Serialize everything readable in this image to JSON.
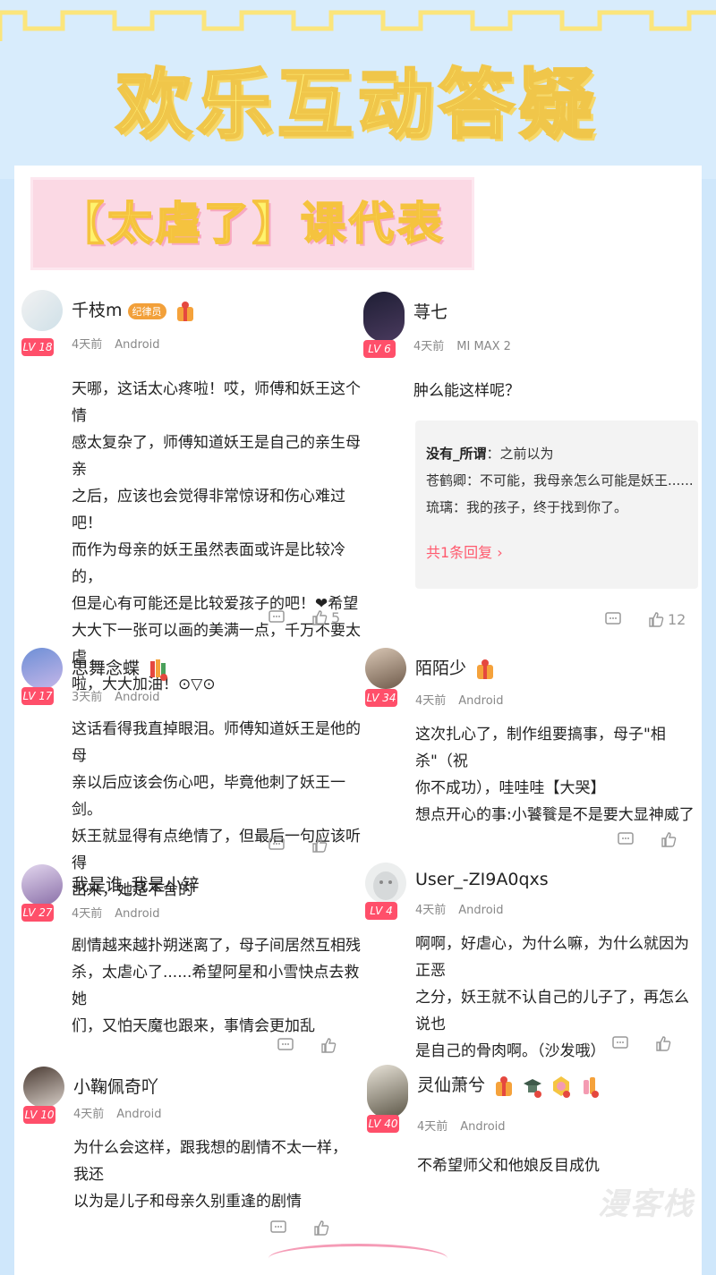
{
  "header": {
    "title": "欢乐互动答疑",
    "banner": "【太虐了】课代表"
  },
  "comments": [
    {
      "username": "千枝m",
      "badge": "纪律员",
      "level": "LV 18",
      "time": "4天前",
      "device": "Android",
      "lines": [
        "天哪，这话太心疼啦！哎，师傅和妖王这个情",
        "感太复杂了，师傅知道妖王是自己的亲生母亲",
        "之后，应该也会觉得非常惊讶和伤心难过吧！",
        "而作为母亲的妖王虽然表面或许是比较冷的，",
        "但是心有可能还是比较爱孩子的吧！❤希望",
        "大大下一张可以画的美满一点，千万不要太虐",
        "啦，大大加油！⊙▽⊙"
      ],
      "likes": "5"
    },
    {
      "username": "荨七",
      "level": "LV 6",
      "time": "4天前",
      "device": "MI MAX 2",
      "lines": [
        "肿么能这样呢？"
      ],
      "reply": {
        "name": "没有_所谓",
        "first": "之前以为",
        "line2": "苍鹤卿：不可能，我母亲怎么可能是妖王......",
        "line3": "琉璃：我的孩子，终于找到你了。",
        "more": "共1条回复 ›"
      },
      "likes": "12"
    },
    {
      "username": "思舞念蝶",
      "medal_num": "8",
      "level": "LV 17",
      "time": "3天前",
      "device": "Android",
      "lines": [
        "这话看得我直掉眼泪。师傅知道妖王是他的母",
        "亲以后应该会伤心吧，毕竟他刺了妖王一剑。",
        "妖王就显得有点绝情了，但最后一句应该听得",
        "出来，她是不舍的"
      ]
    },
    {
      "username": "陌陌少",
      "medal_num": "8",
      "level": "LV 34",
      "time": "4天前",
      "device": "Android",
      "lines": [
        "这次扎心了，制作组要搞事，母子\"相杀\"（祝",
        "你不成功），哇哇哇【大哭】",
        "想点开心的事:小饕餮是不是要大显神威了"
      ]
    },
    {
      "username": "我是谁_我是小锌",
      "level": "LV 27",
      "time": "4天前",
      "device": "Android",
      "lines": [
        "剧情越来越扑朔迷离了，母子间居然互相残",
        "杀，太虐心了......希望阿星和小雪快点去救她",
        "们，又怕天魔也跟来，事情会更加乱"
      ]
    },
    {
      "username": "User_-ZI9A0qxs",
      "level": "LV 4",
      "time": "4天前",
      "device": "Android",
      "lines": [
        "啊啊，好虐心，为什么嘛，为什么就因为正恶",
        "之分，妖王就不认自己的儿子了，再怎么说也",
        "是自己的骨肉啊。（沙发哦）"
      ]
    },
    {
      "username": "小鞠佩奇吖",
      "level": "LV 10",
      "time": "4天前",
      "device": "Android",
      "lines": [
        "为什么会这样，跟我想的剧情不太一样，我还",
        "以为是儿子和母亲久别重逢的剧情"
      ]
    },
    {
      "username": "灵仙萧兮",
      "medal_num": "7",
      "level": "LV 40",
      "time": "4天前",
      "device": "Android",
      "lines": [
        "不希望师父和他娘反目成仇"
      ]
    }
  ],
  "watermark": "漫客栈",
  "colors": {
    "level_badge": "#ff4f6a",
    "reply_more": "#ff5a6e",
    "title_fill": "#fff27a",
    "banner_bg": "#fbd9e4"
  },
  "icons": [
    "comment-icon",
    "thumbs-up-icon",
    "gift-medal-icon"
  ]
}
